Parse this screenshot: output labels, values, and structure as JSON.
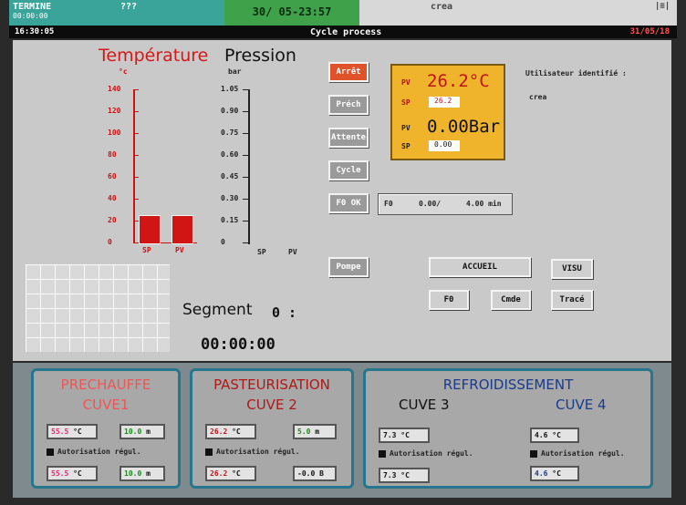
{
  "topbar": {
    "status": "TERMINE",
    "status_sub": "00:00:00",
    "code": "???",
    "datetime": "30/ 05-23:57",
    "user": "crea",
    "time_left": "16:30:05",
    "title": "Cycle process",
    "date_right": "31/05/18"
  },
  "graph": {
    "title_temp": "Température",
    "title_press": "Pression",
    "unit_temp": "°c",
    "unit_press": "bar",
    "temp_ticks": [
      "140",
      "120",
      "100",
      "80",
      "60",
      "40",
      "20",
      "0"
    ],
    "press_ticks": [
      "1.05",
      "0.90",
      "0.75",
      "0.60",
      "0.45",
      "0.30",
      "0.15",
      "0"
    ],
    "temp_bars": [
      "SP",
      "PV"
    ],
    "press_bars": [
      "SP",
      "PV"
    ],
    "temp_values": {
      "sp": 26.2,
      "pv": 26.2
    }
  },
  "buttons": {
    "arret": "Arrêt",
    "prech": "Préch",
    "attente": "Attente",
    "cycle": "Cycle",
    "fo_ok": "F0 OK",
    "pompe": "Pompe",
    "accueil": "ACCUEIL",
    "visu": "VISU",
    "f0": "F0",
    "cmde": "Cmde",
    "trace": "Tracé"
  },
  "process": {
    "pv_label": "PV",
    "sp_label": "SP",
    "temp_pv": "26.2°C",
    "temp_sp": "26.2",
    "press_pv": "0.00Bar",
    "press_sp": "0.00"
  },
  "user_panel": {
    "label": "Utilisateur identifié :",
    "name": "crea"
  },
  "fo": {
    "label": "F0",
    "value": "0.00/",
    "target": "4.00 min"
  },
  "segment": {
    "label": "Segment",
    "number": "0 :",
    "time": "00:00:00"
  },
  "tanks": {
    "prechauffe": {
      "title": "PRECHAUFFE",
      "cuve": "CUVE1",
      "temp1": "55.5",
      "unit1": "°C",
      "val1": "10.0",
      "val1_unit": "m",
      "autoreg": "Autorisation régul.",
      "temp2": "55.5",
      "unit2": "°C",
      "val2": "10.0",
      "val2_unit": "m"
    },
    "pasteurisation": {
      "title": "PASTEURISATION",
      "cuve": "CUVE 2",
      "temp1": "26.2",
      "unit1": "°C",
      "val1": "5.0",
      "val1_unit": "m",
      "autoreg": "Autorisation régul.",
      "temp2": "26.2",
      "unit2": "°C",
      "val2": "-0.0",
      "val2_unit": "B"
    },
    "refroidissement": {
      "title": "REFROIDISSEMENT",
      "cuve3": "CUVE 3",
      "cuve4": "CUVE 4",
      "c3_temp1": "7.3",
      "c3_unit1": "°C",
      "c3_autoreg": "Autorisation régul.",
      "c3_temp2": "7.3",
      "c3_unit2": "°C",
      "c4_temp1": "4.6",
      "c4_unit1": "°C",
      "c4_autoreg": "Autorisation régul.",
      "c4_temp2": "4.6",
      "c4_unit2": "°C"
    }
  },
  "colors": {
    "bar_red": "#d11515",
    "pv_box": "#f0b42c",
    "temp_title": "#d31a1a",
    "pv_text": "#c0141a",
    "tank_border": "#28768c",
    "refroid_title": "#1a3a8a"
  }
}
